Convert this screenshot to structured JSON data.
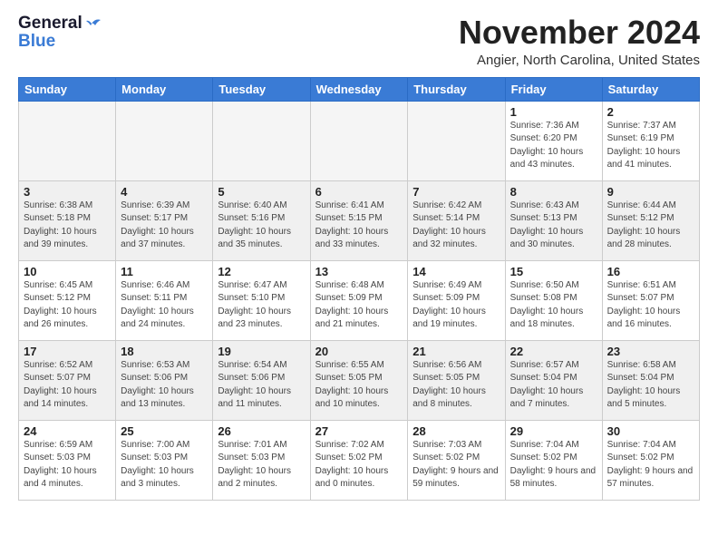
{
  "header": {
    "logo_line1": "General",
    "logo_line2": "Blue",
    "month_title": "November 2024",
    "location": "Angier, North Carolina, United States"
  },
  "days_of_week": [
    "Sunday",
    "Monday",
    "Tuesday",
    "Wednesday",
    "Thursday",
    "Friday",
    "Saturday"
  ],
  "weeks": [
    [
      {
        "day": "",
        "info": ""
      },
      {
        "day": "",
        "info": ""
      },
      {
        "day": "",
        "info": ""
      },
      {
        "day": "",
        "info": ""
      },
      {
        "day": "",
        "info": ""
      },
      {
        "day": "1",
        "info": "Sunrise: 7:36 AM\nSunset: 6:20 PM\nDaylight: 10 hours and 43 minutes."
      },
      {
        "day": "2",
        "info": "Sunrise: 7:37 AM\nSunset: 6:19 PM\nDaylight: 10 hours and 41 minutes."
      }
    ],
    [
      {
        "day": "3",
        "info": "Sunrise: 6:38 AM\nSunset: 5:18 PM\nDaylight: 10 hours and 39 minutes."
      },
      {
        "day": "4",
        "info": "Sunrise: 6:39 AM\nSunset: 5:17 PM\nDaylight: 10 hours and 37 minutes."
      },
      {
        "day": "5",
        "info": "Sunrise: 6:40 AM\nSunset: 5:16 PM\nDaylight: 10 hours and 35 minutes."
      },
      {
        "day": "6",
        "info": "Sunrise: 6:41 AM\nSunset: 5:15 PM\nDaylight: 10 hours and 33 minutes."
      },
      {
        "day": "7",
        "info": "Sunrise: 6:42 AM\nSunset: 5:14 PM\nDaylight: 10 hours and 32 minutes."
      },
      {
        "day": "8",
        "info": "Sunrise: 6:43 AM\nSunset: 5:13 PM\nDaylight: 10 hours and 30 minutes."
      },
      {
        "day": "9",
        "info": "Sunrise: 6:44 AM\nSunset: 5:12 PM\nDaylight: 10 hours and 28 minutes."
      }
    ],
    [
      {
        "day": "10",
        "info": "Sunrise: 6:45 AM\nSunset: 5:12 PM\nDaylight: 10 hours and 26 minutes."
      },
      {
        "day": "11",
        "info": "Sunrise: 6:46 AM\nSunset: 5:11 PM\nDaylight: 10 hours and 24 minutes."
      },
      {
        "day": "12",
        "info": "Sunrise: 6:47 AM\nSunset: 5:10 PM\nDaylight: 10 hours and 23 minutes."
      },
      {
        "day": "13",
        "info": "Sunrise: 6:48 AM\nSunset: 5:09 PM\nDaylight: 10 hours and 21 minutes."
      },
      {
        "day": "14",
        "info": "Sunrise: 6:49 AM\nSunset: 5:09 PM\nDaylight: 10 hours and 19 minutes."
      },
      {
        "day": "15",
        "info": "Sunrise: 6:50 AM\nSunset: 5:08 PM\nDaylight: 10 hours and 18 minutes."
      },
      {
        "day": "16",
        "info": "Sunrise: 6:51 AM\nSunset: 5:07 PM\nDaylight: 10 hours and 16 minutes."
      }
    ],
    [
      {
        "day": "17",
        "info": "Sunrise: 6:52 AM\nSunset: 5:07 PM\nDaylight: 10 hours and 14 minutes."
      },
      {
        "day": "18",
        "info": "Sunrise: 6:53 AM\nSunset: 5:06 PM\nDaylight: 10 hours and 13 minutes."
      },
      {
        "day": "19",
        "info": "Sunrise: 6:54 AM\nSunset: 5:06 PM\nDaylight: 10 hours and 11 minutes."
      },
      {
        "day": "20",
        "info": "Sunrise: 6:55 AM\nSunset: 5:05 PM\nDaylight: 10 hours and 10 minutes."
      },
      {
        "day": "21",
        "info": "Sunrise: 6:56 AM\nSunset: 5:05 PM\nDaylight: 10 hours and 8 minutes."
      },
      {
        "day": "22",
        "info": "Sunrise: 6:57 AM\nSunset: 5:04 PM\nDaylight: 10 hours and 7 minutes."
      },
      {
        "day": "23",
        "info": "Sunrise: 6:58 AM\nSunset: 5:04 PM\nDaylight: 10 hours and 5 minutes."
      }
    ],
    [
      {
        "day": "24",
        "info": "Sunrise: 6:59 AM\nSunset: 5:03 PM\nDaylight: 10 hours and 4 minutes."
      },
      {
        "day": "25",
        "info": "Sunrise: 7:00 AM\nSunset: 5:03 PM\nDaylight: 10 hours and 3 minutes."
      },
      {
        "day": "26",
        "info": "Sunrise: 7:01 AM\nSunset: 5:03 PM\nDaylight: 10 hours and 2 minutes."
      },
      {
        "day": "27",
        "info": "Sunrise: 7:02 AM\nSunset: 5:02 PM\nDaylight: 10 hours and 0 minutes."
      },
      {
        "day": "28",
        "info": "Sunrise: 7:03 AM\nSunset: 5:02 PM\nDaylight: 9 hours and 59 minutes."
      },
      {
        "day": "29",
        "info": "Sunrise: 7:04 AM\nSunset: 5:02 PM\nDaylight: 9 hours and 58 minutes."
      },
      {
        "day": "30",
        "info": "Sunrise: 7:04 AM\nSunset: 5:02 PM\nDaylight: 9 hours and 57 minutes."
      }
    ]
  ]
}
